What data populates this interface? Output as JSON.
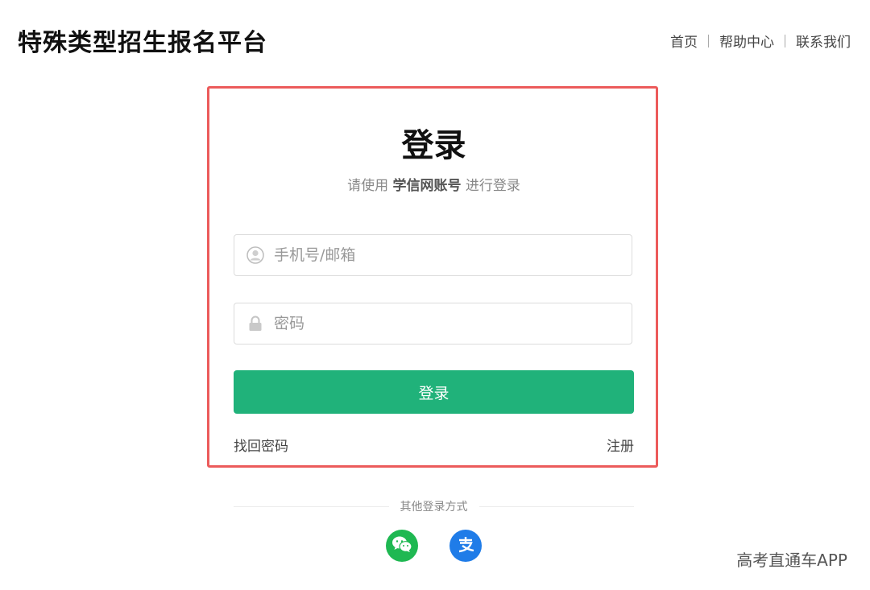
{
  "header": {
    "site_title": "特殊类型招生报名平台",
    "nav": [
      {
        "label": "首页"
      },
      {
        "label": "帮助中心"
      },
      {
        "label": "联系我们"
      }
    ]
  },
  "login": {
    "title": "登录",
    "subtitle_prefix": "请使用",
    "subtitle_account": "学信网账号",
    "subtitle_suffix": "进行登录",
    "username_placeholder": "手机号/邮箱",
    "password_placeholder": "密码",
    "submit_label": "登录",
    "forgot_label": "找回密码",
    "register_label": "注册"
  },
  "other_login": {
    "label": "其他登录方式",
    "providers": [
      {
        "icon": "wechat-icon",
        "color": "#1fb852"
      },
      {
        "icon": "alipay-icon",
        "color": "#1f7ce8"
      }
    ]
  },
  "watermark": "高考直通车APP",
  "colors": {
    "primary_button": "#20b27a",
    "highlight_border": "#ec5b5b"
  }
}
